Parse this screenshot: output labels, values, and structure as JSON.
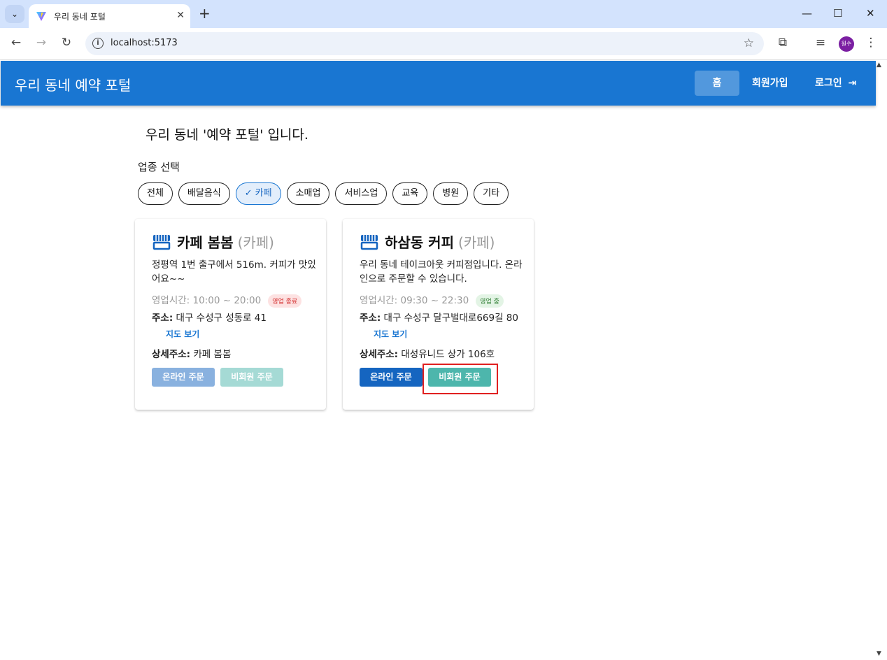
{
  "browser": {
    "tab_title": "우리 동네 포털",
    "url": "localhost:5173",
    "profile_initials": "원수"
  },
  "app": {
    "title": "우리 동네 예약 포털",
    "nav": {
      "home": "홈",
      "signup": "회원가입",
      "login": "로그인"
    },
    "heading": "우리 동네 '예약 포털' 입니다.",
    "category_label": "업종 선택",
    "categories": [
      "전체",
      "배달음식",
      "카페",
      "소매업",
      "서비스업",
      "교육",
      "병원",
      "기타"
    ],
    "selected_category": "카페",
    "stores": [
      {
        "name": "카페 봄봄",
        "category": "(카페)",
        "description": "정평역 1번 출구에서 516m. 커피가 맛있어요~~",
        "hours": "영업시간: 10:00 ~ 20:00",
        "status": "영업 종료",
        "address_label": "주소:",
        "address": "대구 수성구 성동로 41",
        "map_link": "지도 보기",
        "detail_label": "상세주소:",
        "detail_address": "카페 봄봄",
        "online_order": "온라인 주문",
        "guest_order": "비회원 주문",
        "buttons_enabled": false
      },
      {
        "name": "하삼동 커피",
        "category": "(카페)",
        "description": "우리 동네 테이크아웃 커피점입니다. 온라인으로 주문할 수 있습니다.",
        "hours": "영업시간: 09:30 ~ 22:30",
        "status": "영업 중",
        "address_label": "주소:",
        "address": "대구 수성구 달구벌대로669길 80",
        "map_link": "지도 보기",
        "detail_label": "상세주소:",
        "detail_address": "대성유니드 상가 106호",
        "online_order": "온라인 주문",
        "guest_order": "비회원 주문",
        "buttons_enabled": true
      }
    ]
  },
  "colors": {
    "primary": "#1976d2",
    "guest_button": "#4db6ac",
    "highlight": "#e02020"
  }
}
